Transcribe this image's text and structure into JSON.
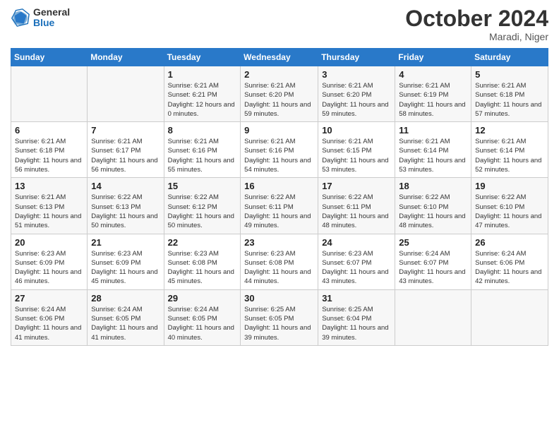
{
  "logo": {
    "general": "General",
    "blue": "Blue"
  },
  "title": "October 2024",
  "location": "Maradi, Niger",
  "days_of_week": [
    "Sunday",
    "Monday",
    "Tuesday",
    "Wednesday",
    "Thursday",
    "Friday",
    "Saturday"
  ],
  "weeks": [
    [
      {
        "day": "",
        "info": ""
      },
      {
        "day": "",
        "info": ""
      },
      {
        "day": "1",
        "info": "Sunrise: 6:21 AM\nSunset: 6:21 PM\nDaylight: 12 hours and 0 minutes."
      },
      {
        "day": "2",
        "info": "Sunrise: 6:21 AM\nSunset: 6:20 PM\nDaylight: 11 hours and 59 minutes."
      },
      {
        "day": "3",
        "info": "Sunrise: 6:21 AM\nSunset: 6:20 PM\nDaylight: 11 hours and 59 minutes."
      },
      {
        "day": "4",
        "info": "Sunrise: 6:21 AM\nSunset: 6:19 PM\nDaylight: 11 hours and 58 minutes."
      },
      {
        "day": "5",
        "info": "Sunrise: 6:21 AM\nSunset: 6:18 PM\nDaylight: 11 hours and 57 minutes."
      }
    ],
    [
      {
        "day": "6",
        "info": "Sunrise: 6:21 AM\nSunset: 6:18 PM\nDaylight: 11 hours and 56 minutes."
      },
      {
        "day": "7",
        "info": "Sunrise: 6:21 AM\nSunset: 6:17 PM\nDaylight: 11 hours and 56 minutes."
      },
      {
        "day": "8",
        "info": "Sunrise: 6:21 AM\nSunset: 6:16 PM\nDaylight: 11 hours and 55 minutes."
      },
      {
        "day": "9",
        "info": "Sunrise: 6:21 AM\nSunset: 6:16 PM\nDaylight: 11 hours and 54 minutes."
      },
      {
        "day": "10",
        "info": "Sunrise: 6:21 AM\nSunset: 6:15 PM\nDaylight: 11 hours and 53 minutes."
      },
      {
        "day": "11",
        "info": "Sunrise: 6:21 AM\nSunset: 6:14 PM\nDaylight: 11 hours and 53 minutes."
      },
      {
        "day": "12",
        "info": "Sunrise: 6:21 AM\nSunset: 6:14 PM\nDaylight: 11 hours and 52 minutes."
      }
    ],
    [
      {
        "day": "13",
        "info": "Sunrise: 6:21 AM\nSunset: 6:13 PM\nDaylight: 11 hours and 51 minutes."
      },
      {
        "day": "14",
        "info": "Sunrise: 6:22 AM\nSunset: 6:13 PM\nDaylight: 11 hours and 50 minutes."
      },
      {
        "day": "15",
        "info": "Sunrise: 6:22 AM\nSunset: 6:12 PM\nDaylight: 11 hours and 50 minutes."
      },
      {
        "day": "16",
        "info": "Sunrise: 6:22 AM\nSunset: 6:11 PM\nDaylight: 11 hours and 49 minutes."
      },
      {
        "day": "17",
        "info": "Sunrise: 6:22 AM\nSunset: 6:11 PM\nDaylight: 11 hours and 48 minutes."
      },
      {
        "day": "18",
        "info": "Sunrise: 6:22 AM\nSunset: 6:10 PM\nDaylight: 11 hours and 48 minutes."
      },
      {
        "day": "19",
        "info": "Sunrise: 6:22 AM\nSunset: 6:10 PM\nDaylight: 11 hours and 47 minutes."
      }
    ],
    [
      {
        "day": "20",
        "info": "Sunrise: 6:23 AM\nSunset: 6:09 PM\nDaylight: 11 hours and 46 minutes."
      },
      {
        "day": "21",
        "info": "Sunrise: 6:23 AM\nSunset: 6:09 PM\nDaylight: 11 hours and 45 minutes."
      },
      {
        "day": "22",
        "info": "Sunrise: 6:23 AM\nSunset: 6:08 PM\nDaylight: 11 hours and 45 minutes."
      },
      {
        "day": "23",
        "info": "Sunrise: 6:23 AM\nSunset: 6:08 PM\nDaylight: 11 hours and 44 minutes."
      },
      {
        "day": "24",
        "info": "Sunrise: 6:23 AM\nSunset: 6:07 PM\nDaylight: 11 hours and 43 minutes."
      },
      {
        "day": "25",
        "info": "Sunrise: 6:24 AM\nSunset: 6:07 PM\nDaylight: 11 hours and 43 minutes."
      },
      {
        "day": "26",
        "info": "Sunrise: 6:24 AM\nSunset: 6:06 PM\nDaylight: 11 hours and 42 minutes."
      }
    ],
    [
      {
        "day": "27",
        "info": "Sunrise: 6:24 AM\nSunset: 6:06 PM\nDaylight: 11 hours and 41 minutes."
      },
      {
        "day": "28",
        "info": "Sunrise: 6:24 AM\nSunset: 6:05 PM\nDaylight: 11 hours and 41 minutes."
      },
      {
        "day": "29",
        "info": "Sunrise: 6:24 AM\nSunset: 6:05 PM\nDaylight: 11 hours and 40 minutes."
      },
      {
        "day": "30",
        "info": "Sunrise: 6:25 AM\nSunset: 6:05 PM\nDaylight: 11 hours and 39 minutes."
      },
      {
        "day": "31",
        "info": "Sunrise: 6:25 AM\nSunset: 6:04 PM\nDaylight: 11 hours and 39 minutes."
      },
      {
        "day": "",
        "info": ""
      },
      {
        "day": "",
        "info": ""
      }
    ]
  ]
}
